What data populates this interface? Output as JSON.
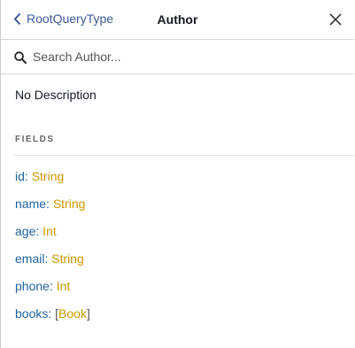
{
  "header": {
    "back_label": "RootQueryType",
    "title": "Author",
    "close_icon": "close-icon",
    "back_icon": "chevron-left-icon"
  },
  "search": {
    "placeholder": "Search Author...",
    "value": "",
    "icon": "search-icon"
  },
  "description": "No Description",
  "fields_section": {
    "title": "FIELDS",
    "items": [
      {
        "name": "id",
        "type": "String",
        "list": false
      },
      {
        "name": "name",
        "type": "String",
        "list": false
      },
      {
        "name": "age",
        "type": "Int",
        "list": false
      },
      {
        "name": "email",
        "type": "String",
        "list": false
      },
      {
        "name": "phone",
        "type": "Int",
        "list": false
      },
      {
        "name": "books",
        "type": "Book",
        "list": true
      }
    ]
  },
  "colors": {
    "link": "#3b5998",
    "field_name": "#1f61a0",
    "type_name": "#ca9800",
    "divider": "#d6d6d6"
  }
}
